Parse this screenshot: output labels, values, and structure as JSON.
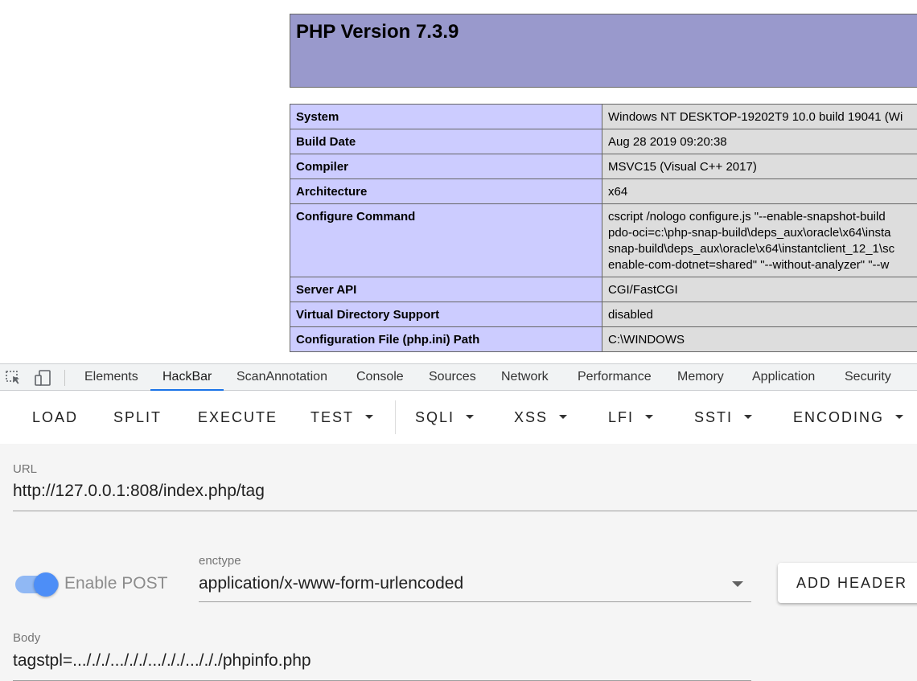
{
  "phpinfo": {
    "title": "PHP Version 7.3.9",
    "rows": [
      {
        "key": "System",
        "value": [
          "Windows NT DESKTOP-19202T9 10.0 build 19041 (Wi"
        ]
      },
      {
        "key": "Build Date",
        "value": [
          "Aug 28 2019 09:20:38"
        ]
      },
      {
        "key": "Compiler",
        "value": [
          "MSVC15 (Visual C++ 2017)"
        ]
      },
      {
        "key": "Architecture",
        "value": [
          "x64"
        ]
      },
      {
        "key": "Configure Command",
        "value": [
          "cscript /nologo configure.js \"--enable-snapshot-build",
          "pdo-oci=c:\\php-snap-build\\deps_aux\\oracle\\x64\\insta",
          "snap-build\\deps_aux\\oracle\\x64\\instantclient_12_1\\sc",
          "enable-com-dotnet=shared\" \"--without-analyzer\" \"--w"
        ]
      },
      {
        "key": "Server API",
        "value": [
          "CGI/FastCGI"
        ]
      },
      {
        "key": "Virtual Directory Support",
        "value": [
          "disabled"
        ]
      },
      {
        "key": "Configuration File (php.ini) Path",
        "value": [
          "C:\\WINDOWS"
        ]
      }
    ]
  },
  "devtools": {
    "tabs": [
      "Elements",
      "HackBar",
      "ScanAnnotation",
      "Console",
      "Sources",
      "Network",
      "Performance",
      "Memory",
      "Application",
      "Security"
    ],
    "active_tab": "HackBar",
    "accent": "#1a73e8"
  },
  "hackbar": {
    "toolbar": {
      "load": "LOAD",
      "split": "SPLIT",
      "execute": "EXECUTE",
      "test": "TEST",
      "sqli": "SQLI",
      "xss": "XSS",
      "lfi": "LFI",
      "ssti": "SSTI",
      "encoding": "ENCODING"
    },
    "url": {
      "label": "URL",
      "value": "http://127.0.0.1:808/index.php/tag"
    },
    "enable_post": {
      "label": "Enable POST",
      "checked": true
    },
    "enctype": {
      "label": "enctype",
      "value": "application/x-www-form-urlencoded"
    },
    "add_header": "ADD HEADER",
    "body": {
      "label": "Body",
      "value": "tagstpl=.../././.../././.../././.../././phpinfo.php"
    }
  }
}
